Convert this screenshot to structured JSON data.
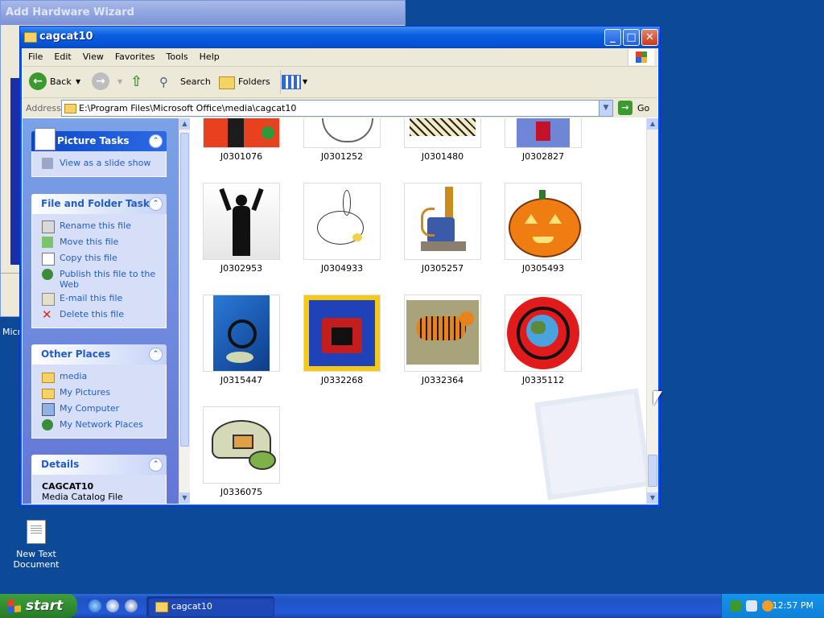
{
  "background_window": {
    "title": "Add Hardware Wizard"
  },
  "desktop_partial_label": "Micr",
  "desktop_icon": {
    "label_line1": "New Text",
    "label_line2": "Document"
  },
  "window": {
    "title": "cagcat10",
    "controls": {
      "minimize": "_",
      "maximize": "□",
      "close": "✕"
    }
  },
  "menu": [
    "File",
    "Edit",
    "View",
    "Favorites",
    "Tools",
    "Help"
  ],
  "toolbar": {
    "back": "Back",
    "search": "Search",
    "folders": "Folders"
  },
  "address": {
    "label": "Address",
    "path": "E:\\Program Files\\Microsoft Office\\media\\cagcat10",
    "go": "Go"
  },
  "picture_tasks": {
    "title": "Picture Tasks",
    "items": [
      "View as a slide show"
    ]
  },
  "file_tasks": {
    "title": "File and Folder Tasks",
    "items": [
      "Rename this file",
      "Move this file",
      "Copy this file",
      "Publish this file to the Web",
      "E-mail this file",
      "Delete this file"
    ]
  },
  "other_places": {
    "title": "Other Places",
    "items": [
      "media",
      "My Pictures",
      "My Computer",
      "My Network Places"
    ]
  },
  "details": {
    "title": "Details",
    "name": "CAGCAT10",
    "type": "Media Catalog File"
  },
  "thumbnails": [
    {
      "name": "J0301076"
    },
    {
      "name": "J0301252"
    },
    {
      "name": "J0301480"
    },
    {
      "name": "J0302827"
    },
    {
      "name": "J0302953"
    },
    {
      "name": "J0304933"
    },
    {
      "name": "J0305257"
    },
    {
      "name": "J0305493"
    },
    {
      "name": "J0315447"
    },
    {
      "name": "J0332268"
    },
    {
      "name": "J0332364"
    },
    {
      "name": "J0335112"
    },
    {
      "name": "J0336075"
    }
  ],
  "taskbar": {
    "start": "start",
    "task": "cagcat10",
    "clock": "12:57 PM"
  },
  "colors": {
    "title_blue": "#0a5ddd",
    "taskbar_blue": "#245ad6",
    "start_green": "#2f8a2f",
    "link_blue": "#215dc6"
  }
}
